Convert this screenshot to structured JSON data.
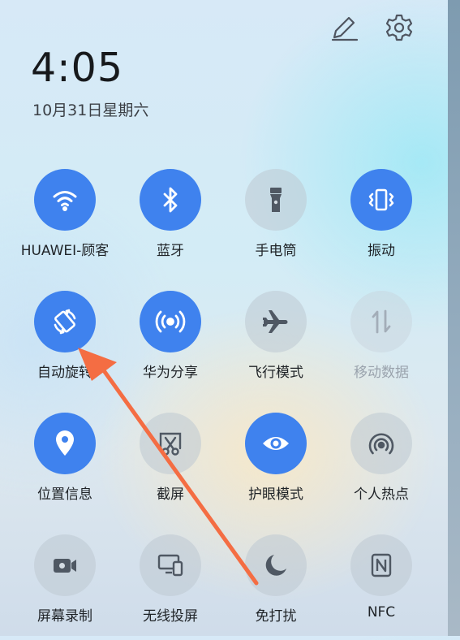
{
  "status": {
    "time": "4:05",
    "date": "10月31日星期六"
  },
  "header_icons": [
    "edit-icon",
    "settings-icon"
  ],
  "colors": {
    "active": "#3f82ee",
    "inactive": "#c0c8d2",
    "annotation_arrow": "#f46d43"
  },
  "toggles": [
    {
      "label": "HUAWEI-顾客",
      "icon": "wifi-icon",
      "state": "on"
    },
    {
      "label": "蓝牙",
      "icon": "bluetooth-icon",
      "state": "on"
    },
    {
      "label": "手电筒",
      "icon": "flashlight-icon",
      "state": "off"
    },
    {
      "label": "振动",
      "icon": "vibrate-icon",
      "state": "on"
    },
    {
      "label": "自动旋转",
      "icon": "auto-rotate-icon",
      "state": "on"
    },
    {
      "label": "华为分享",
      "icon": "huawei-share-icon",
      "state": "on"
    },
    {
      "label": "飞行模式",
      "icon": "airplane-icon",
      "state": "off"
    },
    {
      "label": "移动数据",
      "icon": "mobile-data-icon",
      "state": "disabled"
    },
    {
      "label": "位置信息",
      "icon": "location-icon",
      "state": "on"
    },
    {
      "label": "截屏",
      "icon": "screenshot-icon",
      "state": "off"
    },
    {
      "label": "护眼模式",
      "icon": "eye-comfort-icon",
      "state": "on"
    },
    {
      "label": "个人热点",
      "icon": "hotspot-icon",
      "state": "off"
    },
    {
      "label": "屏幕录制",
      "icon": "screen-record-icon",
      "state": "off"
    },
    {
      "label": "无线投屏",
      "icon": "wireless-projection-icon",
      "state": "off"
    },
    {
      "label": "免打扰",
      "icon": "do-not-disturb-icon",
      "state": "off"
    },
    {
      "label": "NFC",
      "icon": "nfc-icon",
      "state": "off"
    }
  ]
}
